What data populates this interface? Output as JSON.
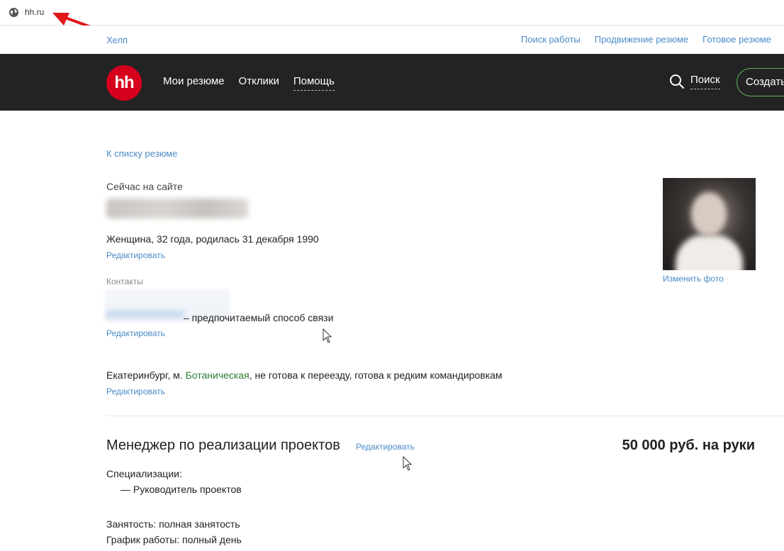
{
  "browser": {
    "url": "hh.ru"
  },
  "topnav": {
    "left_link": "Хелп",
    "links": [
      "Поиск работы",
      "Продвижение резюме",
      "Готовое резюме"
    ]
  },
  "header": {
    "logo": "hh",
    "nav": [
      "Мои резюме",
      "Отклики",
      "Помощь"
    ],
    "search_label": "Поиск",
    "create_label": "Создать"
  },
  "resume": {
    "back_link": "К списку резюме",
    "online_status": "Сейчас на сайте",
    "name": "Иванова Анна",
    "bio": "Женщина, 32 года, родилась 31 декабря 1990",
    "edit_label": "Редактировать",
    "contacts_label": "Контакты",
    "contact_value": "+7 (900) 000-00-00",
    "contact_pref": "– предпочитаемый способ связи",
    "location": {
      "city": "Екатеринбург, м. ",
      "metro": "Ботаническая",
      "rest": ", не готова к переезду, готова к редким командировкам"
    },
    "change_photo": "Изменить фото",
    "position": "Менеджер по реализации проектов",
    "salary": "50 000 руб. на руки",
    "spec_label": "Специализации:",
    "spec_item": "— Руководитель проектов",
    "employment": "Занятость: полная занятость",
    "schedule": "График работы: полный день"
  },
  "colors": {
    "accent_link": "#4a8bc7",
    "header_bg": "#232323",
    "logo_red": "#d6001c",
    "create_border": "#62b45a",
    "metro_green": "#2e7d32",
    "annotation_arrow": "#e0181b"
  }
}
